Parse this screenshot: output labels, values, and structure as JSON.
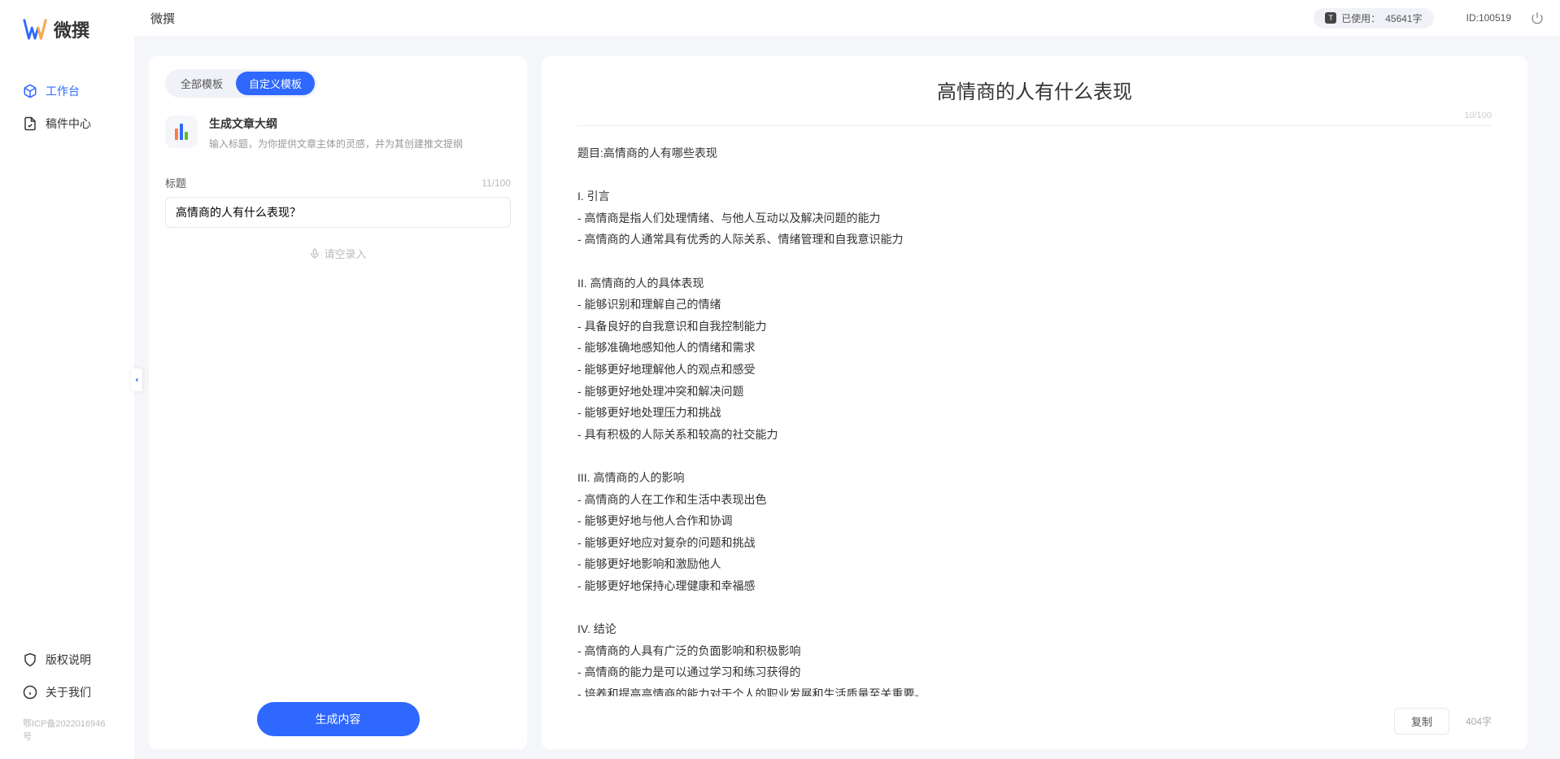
{
  "app": {
    "name": "微撰",
    "icp": "鄂ICP备2022016946号"
  },
  "sidebar": {
    "nav": [
      {
        "label": "工作台",
        "active": true
      },
      {
        "label": "稿件中心",
        "active": false
      }
    ],
    "bottom": [
      {
        "label": "版权说明"
      },
      {
        "label": "关于我们"
      }
    ]
  },
  "topbar": {
    "title": "微撰",
    "usage_prefix": "已使用：",
    "usage_value": "45641字",
    "user_id": "ID:100519"
  },
  "left_panel": {
    "tabs": [
      {
        "label": "全部模板",
        "active": false
      },
      {
        "label": "自定义模板",
        "active": true
      }
    ],
    "template": {
      "title": "生成文章大纲",
      "desc": "输入标题，为你提供文章主体的灵感，并为其创建推文提纲"
    },
    "field": {
      "label": "标题",
      "counter": "11/100",
      "value": "高情商的人有什么表现？"
    },
    "voice_hint": "请空录入",
    "generate_btn": "生成内容"
  },
  "right_panel": {
    "title": "高情商的人有什么表现",
    "title_counter": "10/100",
    "content": "题目:高情商的人有哪些表现\n\nI. 引言\n- 高情商是指人们处理情绪、与他人互动以及解决问题的能力\n- 高情商的人通常具有优秀的人际关系、情绪管理和自我意识能力\n\nII. 高情商的人的具体表现\n- 能够识别和理解自己的情绪\n- 具备良好的自我意识和自我控制能力\n- 能够准确地感知他人的情绪和需求\n- 能够更好地理解他人的观点和感受\n- 能够更好地处理冲突和解决问题\n- 能够更好地处理压力和挑战\n- 具有积极的人际关系和较高的社交能力\n\nIII. 高情商的人的影响\n- 高情商的人在工作和生活中表现出色\n- 能够更好地与他人合作和协调\n- 能够更好地应对复杂的问题和挑战\n- 能够更好地影响和激励他人\n- 能够更好地保持心理健康和幸福感\n\nIV. 结论\n- 高情商的人具有广泛的负面影响和积极影响\n- 高情商的能力是可以通过学习和练习获得的\n- 培养和提高高情商的能力对于个人的职业发展和生活质量至关重要。",
    "copy_btn": "复制",
    "word_count": "404字"
  }
}
